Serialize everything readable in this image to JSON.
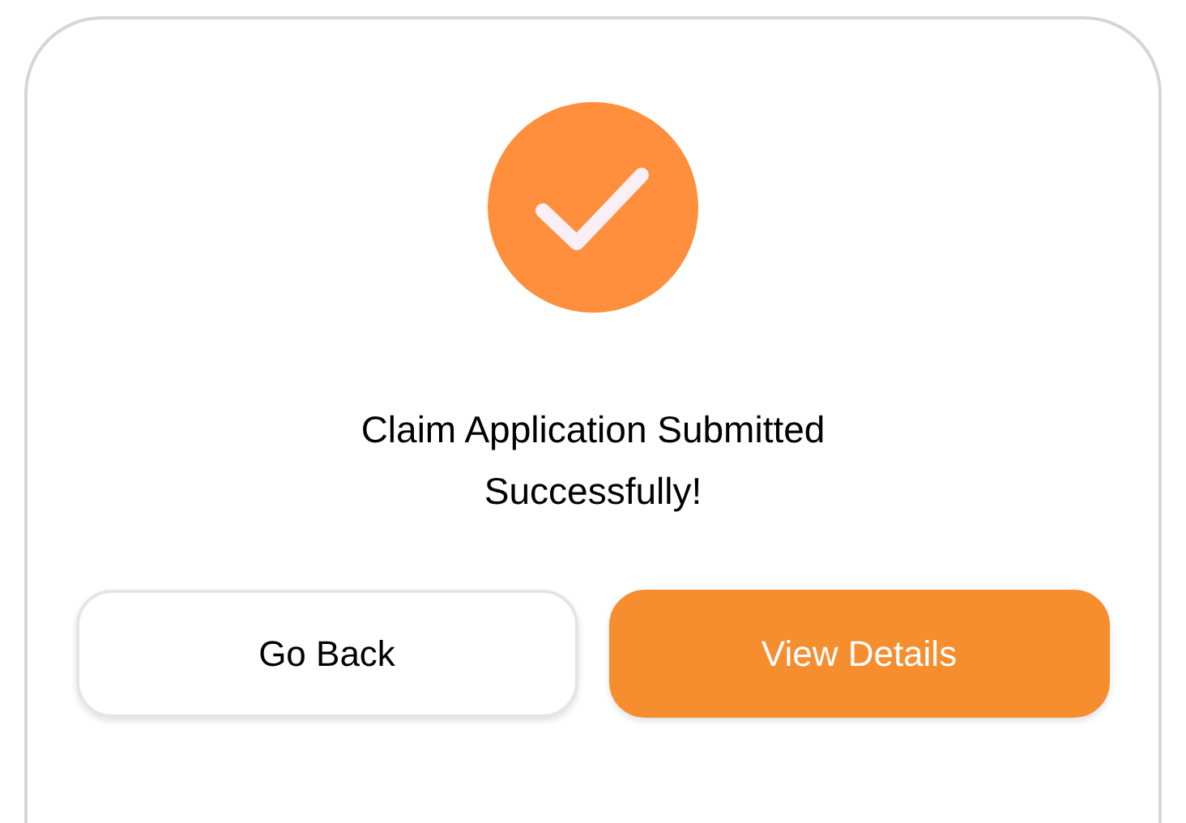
{
  "dialog": {
    "title": "Claim Application Submitted Successfully!",
    "buttons": [
      {
        "label": "Go Back",
        "kind": "secondary"
      },
      {
        "label": "View Details",
        "kind": "primary"
      }
    ]
  }
}
